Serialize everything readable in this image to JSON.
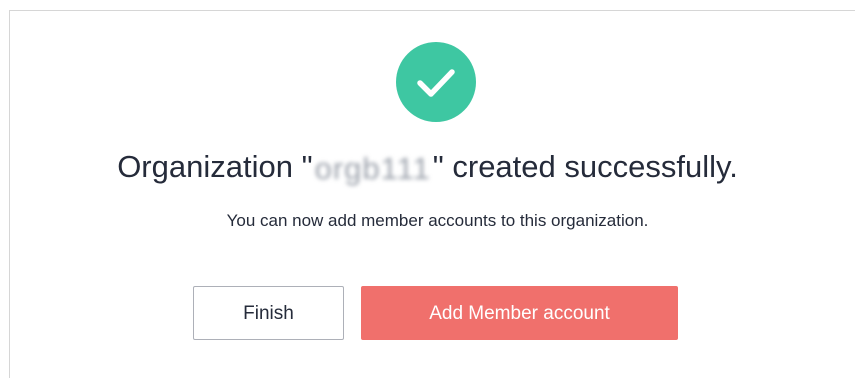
{
  "success": {
    "icon": "check-circle-icon",
    "icon_color": "#3ec7a2"
  },
  "title": {
    "prefix": "Organization \"",
    "name": "orgb111",
    "suffix": "\" created successfully."
  },
  "subtitle": "You can now add member accounts to this organization.",
  "actions": {
    "finish_label": "Finish",
    "add_member_label": "Add Member account",
    "primary_color": "#f0706c"
  }
}
